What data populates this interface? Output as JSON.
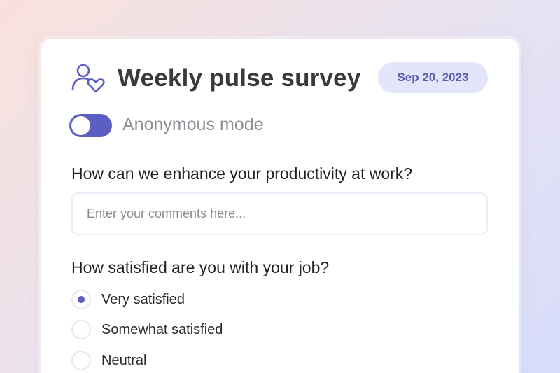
{
  "survey": {
    "icon": "user-heart-icon",
    "title": "Weekly pulse survey",
    "date": "Sep 20, 2023",
    "accent_color": "#5b5fc4",
    "badge_bg": "#e3e5fb"
  },
  "anonymous": {
    "label": "Anonymous mode",
    "enabled": true
  },
  "productivity_question": {
    "text": "How can we enhance your productivity at work?",
    "value": "",
    "placeholder": "Enter your comments here..."
  },
  "satisfaction_question": {
    "text": "How satisfied are you with your job?",
    "selected": "Very satisfied",
    "options": [
      {
        "label": "Very satisfied",
        "checked": true
      },
      {
        "label": "Somewhat satisfied",
        "checked": false
      },
      {
        "label": "Neutral",
        "checked": false
      }
    ]
  }
}
